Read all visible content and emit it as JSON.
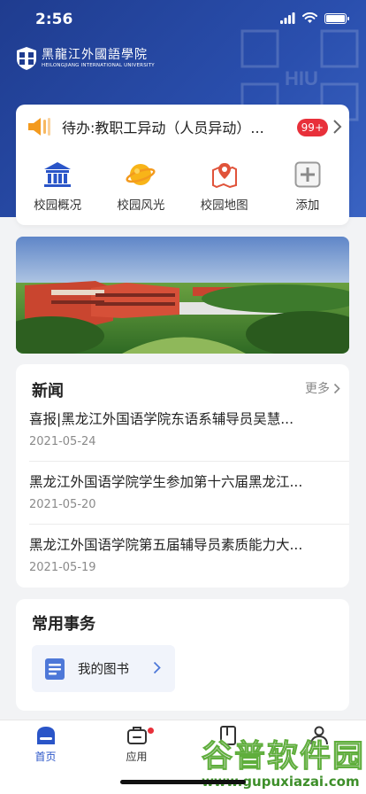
{
  "status_bar": {
    "time": "2:56"
  },
  "header": {
    "logo_cn": "黑龍江外國語學院",
    "logo_en": "HEILONGJIANG INTERNATIONAL UNIVERSITY",
    "watermark_text": "HIU"
  },
  "todo": {
    "text": "待办:教职工异动（人员异动）...",
    "badge": "99+"
  },
  "quick_actions": [
    {
      "label": "校园概况",
      "icon": "building-icon"
    },
    {
      "label": "校园风光",
      "icon": "planet-icon"
    },
    {
      "label": "校园地图",
      "icon": "map-pin-icon"
    },
    {
      "label": "添加",
      "icon": "add-icon"
    }
  ],
  "news": {
    "title": "新闻",
    "more": "更多",
    "items": [
      {
        "title": "喜报|黑龙江外国语学院东语系辅导员吴慧...",
        "date": "2021-05-24"
      },
      {
        "title": "黑龙江外国语学院学生参加第十六届黑龙江...",
        "date": "2021-05-20"
      },
      {
        "title": "黑龙江外国语学院第五届辅导员素质能力大...",
        "date": "2021-05-19"
      }
    ]
  },
  "affairs": {
    "title": "常用事务",
    "items": [
      {
        "label": "我的图书"
      }
    ]
  },
  "tabbar": {
    "items": [
      {
        "label": "首页",
        "active": true
      },
      {
        "label": "应用",
        "active": false
      },
      {
        "label": "",
        "active": false
      },
      {
        "label": "",
        "active": false
      }
    ]
  },
  "site_watermark": {
    "name": "谷普软件园",
    "url": "www.gupuxiazai.com"
  },
  "colors": {
    "primary": "#2a55c8",
    "header": "#1f3c8f",
    "badge": "#e8303a",
    "orange": "#f39a1e"
  }
}
